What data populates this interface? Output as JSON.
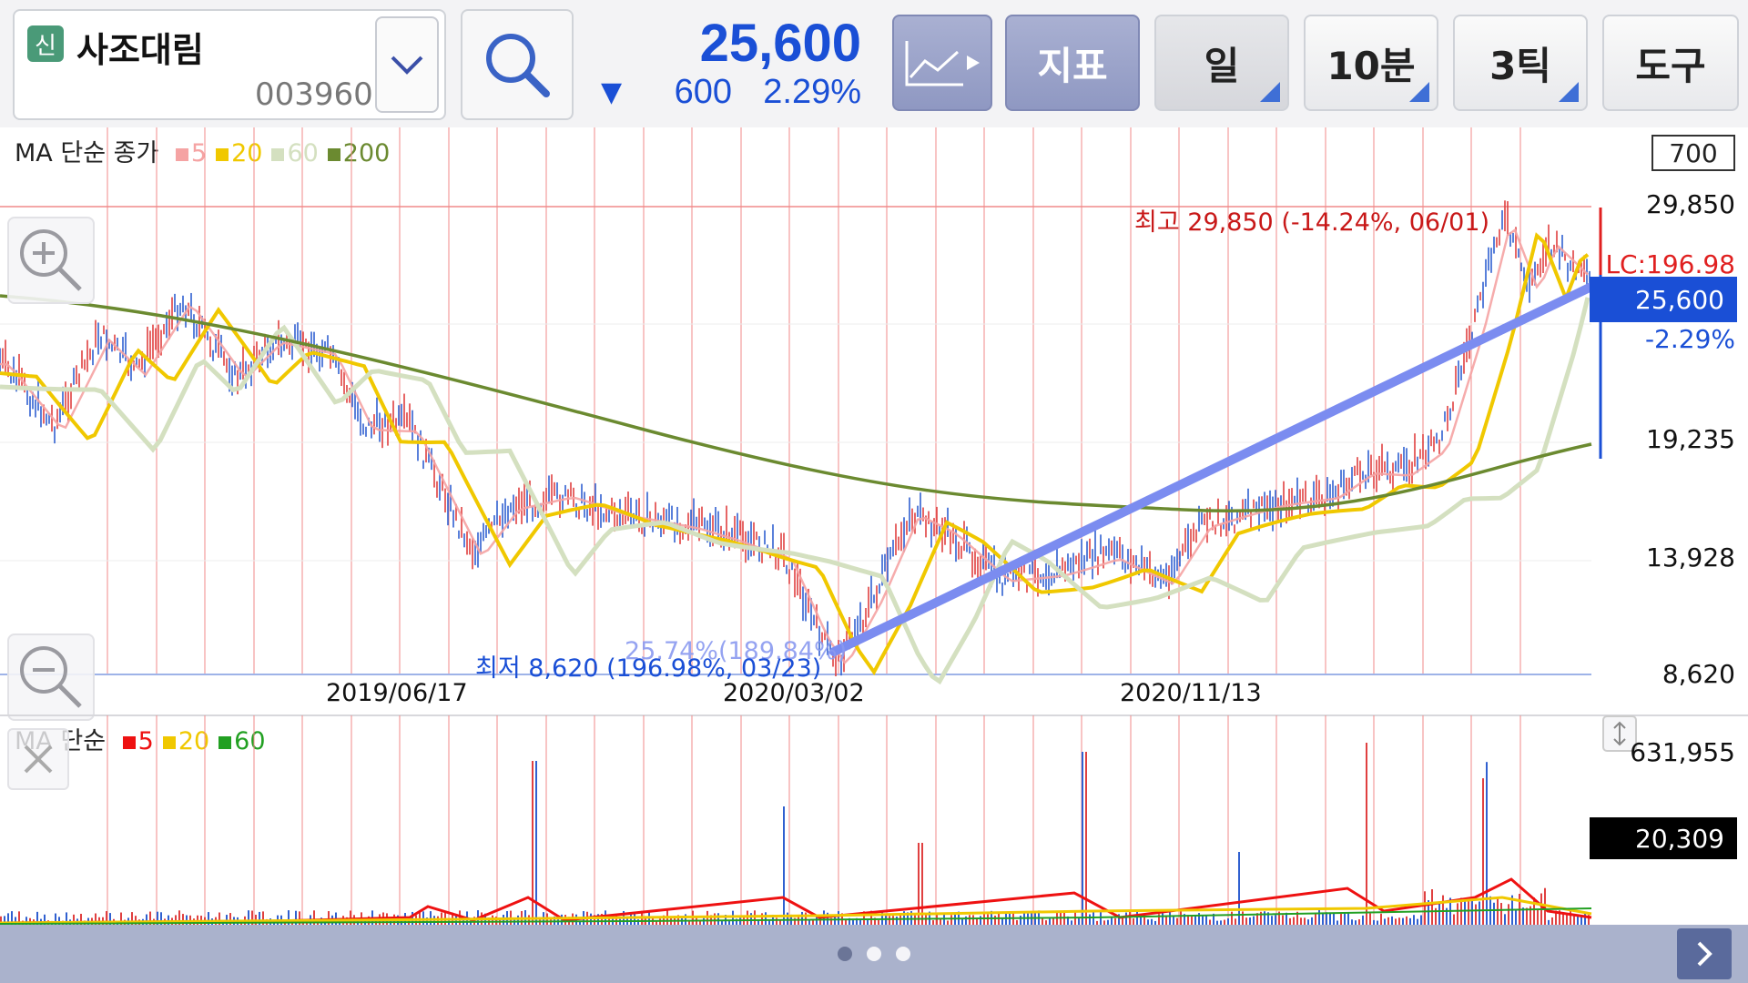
{
  "stock": {
    "badge": "신",
    "name": "사조대림",
    "code": "003960"
  },
  "quote": {
    "price": "25,600",
    "arrow": "▼",
    "change": "600",
    "change_pct": "2.29%"
  },
  "toolbar": {
    "indicator": "지표",
    "period": "일",
    "interval": "10분",
    "ticks": "3틱",
    "tools": "도구"
  },
  "price_chart": {
    "legend_title": "MA 단순 종가",
    "legend": [
      {
        "label": "5",
        "color": "#f5a3a3"
      },
      {
        "label": "20",
        "color": "#f0c800"
      },
      {
        "label": "60",
        "color": "#d4e0c0"
      },
      {
        "label": "200",
        "color": "#6b8a30"
      }
    ],
    "top_box": "700",
    "y_ticks": [
      "29,850",
      "19,235",
      "13,928",
      "8,620"
    ],
    "lc_label": "LC:196.98",
    "current_price": "25,600",
    "current_pct": "-2.29%",
    "high_label": "최고 29,850 (-14.24%, 06/01)",
    "low_label": "최저 8,620 (196.98%, 03/23)",
    "trend_label": "25.74%(189.84%)",
    "x_labels": [
      "2019/06/17",
      "2020/03/02",
      "2020/11/13"
    ]
  },
  "volume_chart": {
    "legend_title": "MA 단순",
    "legend": [
      {
        "label": "5",
        "color": "#ee1111"
      },
      {
        "label": "20",
        "color": "#f0c800"
      },
      {
        "label": "60",
        "color": "#22a022"
      }
    ],
    "y_top": "631,955",
    "current": "20,309"
  },
  "colors": {
    "accent": "#1a4fd6",
    "up": "#e02020",
    "trendline": "#7b8cf0"
  },
  "icons": [
    "search-icon",
    "line-chart-icon",
    "zoom-in-icon",
    "zoom-out-icon",
    "close-icon",
    "resize-icon",
    "chevron-down-icon",
    "chevron-right-icon"
  ]
}
